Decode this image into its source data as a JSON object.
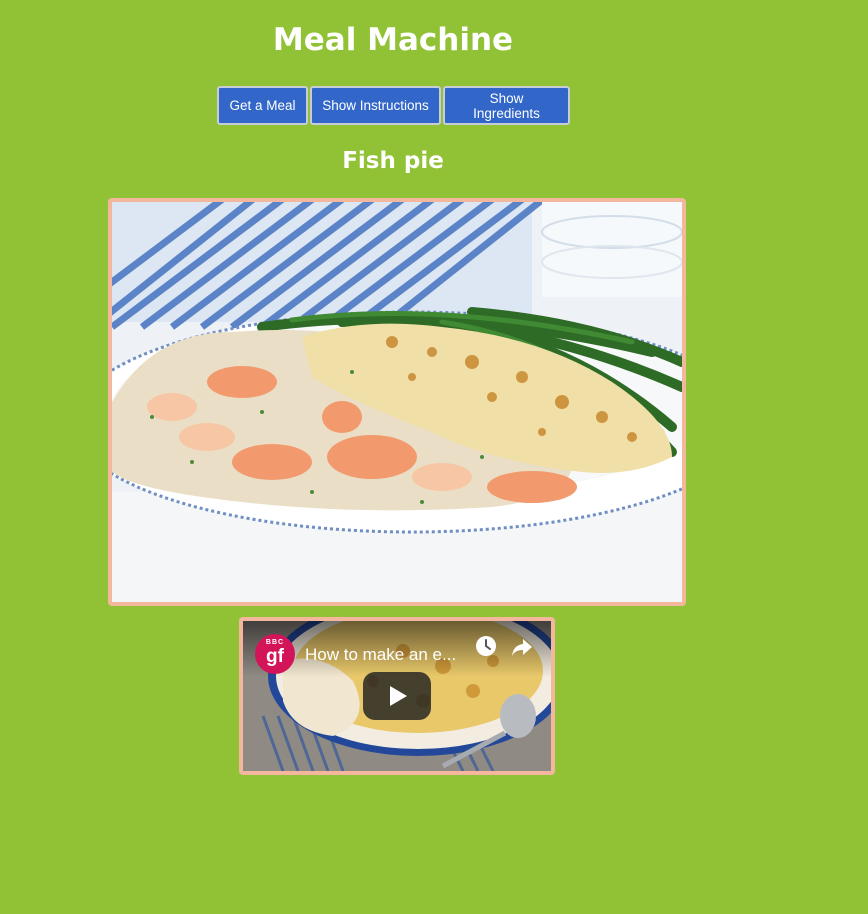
{
  "app": {
    "title": "Meal Machine"
  },
  "buttons": {
    "get_meal": "Get a Meal",
    "show_instructions": "Show Instructions",
    "show_ingredients": "Show Ingredients"
  },
  "meal": {
    "name": "Fish pie",
    "image_alt": "Fish pie"
  },
  "video": {
    "title": "How to make an e...",
    "channel_logo_small": "BBC",
    "channel_logo": "gf"
  },
  "colors": {
    "background": "#91c236",
    "button": "#3267c9",
    "frame_border": "#f3b79e",
    "channel_logo": "#d41458"
  },
  "icons": {
    "watch_later": "clock-icon",
    "share": "share-arrow-icon",
    "play": "play-icon"
  }
}
